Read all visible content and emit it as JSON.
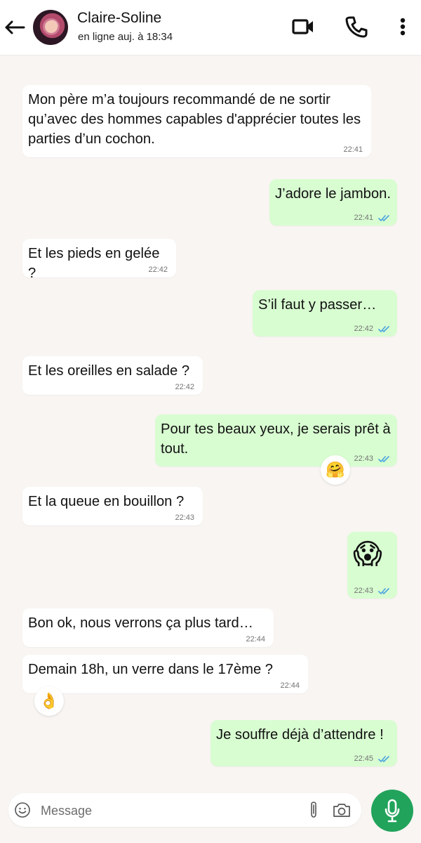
{
  "contact": {
    "name": "Claire-Soline",
    "status": "en ligne auj. à 18:34"
  },
  "header_icons": [
    "back-arrow-icon",
    "video-camera-icon",
    "phone-icon",
    "more-vertical-icon"
  ],
  "messages": [
    {
      "direction": "in",
      "text": "Mon père m’a toujours recommandé de ne sortir qu’avec des hommes capables d'apprécier toutes les parties d’un cochon.",
      "time": "22:41"
    },
    {
      "direction": "out",
      "text": "J’adore le jambon.",
      "time": "22:41",
      "status": "read"
    },
    {
      "direction": "in",
      "text": "Et les pieds en gelée ?",
      "time": "22:42"
    },
    {
      "direction": "out",
      "text": "S’il faut y passer…",
      "time": "22:42",
      "status": "read"
    },
    {
      "direction": "in",
      "text": "Et les oreilles en salade ?",
      "time": "22:42"
    },
    {
      "direction": "out",
      "text": "Pour tes beaux yeux, je serais prêt à tout.",
      "time": "22:43",
      "status": "read",
      "reaction": "🤗"
    },
    {
      "direction": "in",
      "text": "Et la queue en bouillon ?",
      "time": "22:43"
    },
    {
      "direction": "out",
      "text": "😱",
      "time": "22:43",
      "status": "read"
    },
    {
      "direction": "in",
      "text": "Bon ok, nous verrons ça plus tard…",
      "time": "22:44"
    },
    {
      "direction": "in",
      "text": "Demain 18h, un verre dans le 17ème ?",
      "time": "22:44",
      "reaction": "👌"
    },
    {
      "direction": "out",
      "text": "Je souffre déjà d’attendre !",
      "time": "22:45",
      "status": "read"
    }
  ],
  "composer": {
    "placeholder": "Message",
    "value": "",
    "icons": [
      "emoji-icon",
      "paperclip-icon",
      "camera-icon",
      "microphone-icon"
    ]
  },
  "colors": {
    "background": "#f8f5f2",
    "incoming_bubble": "#ffffff",
    "outgoing_bubble": "#d8fdd1",
    "read_check": "#4aa3df",
    "accent": "#21a35b"
  }
}
